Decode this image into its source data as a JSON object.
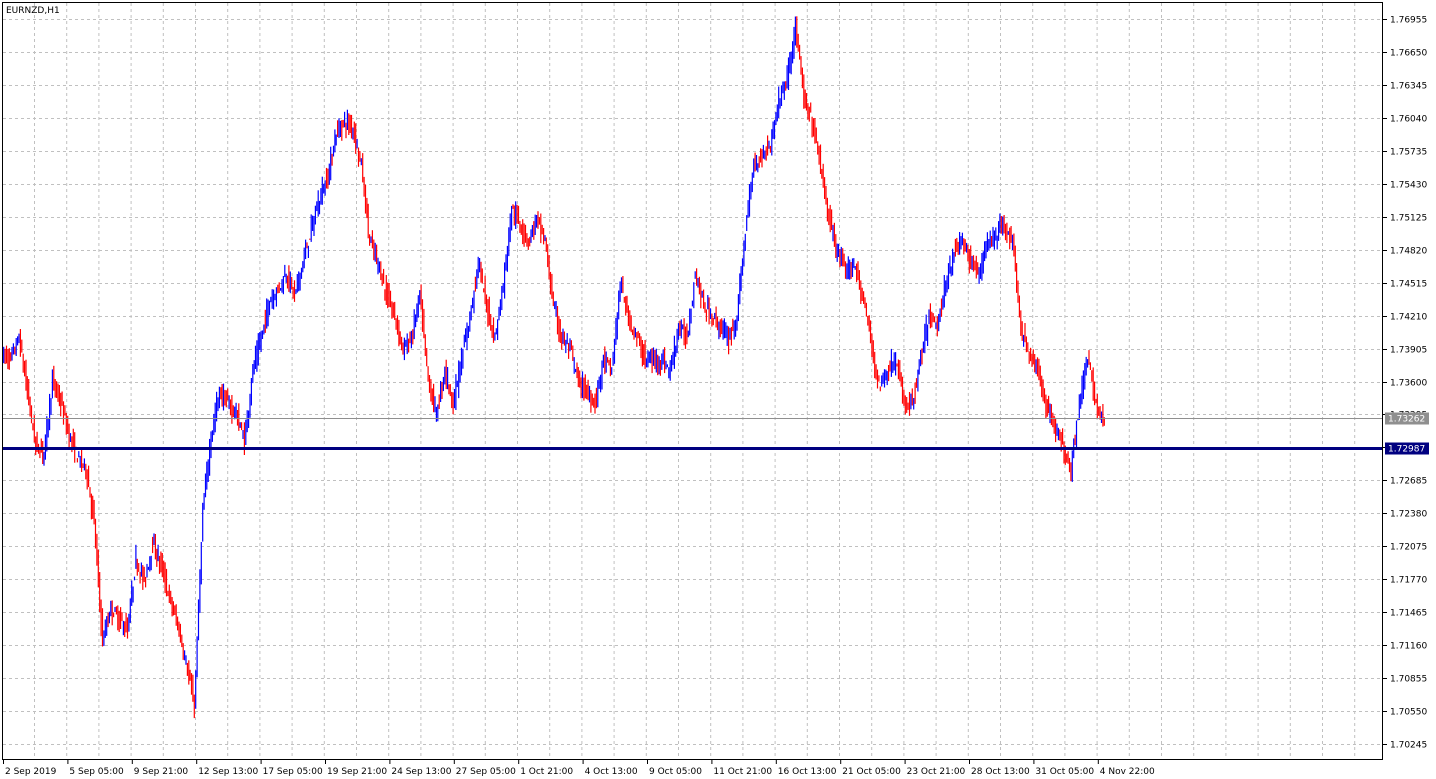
{
  "window": {
    "title": "EURNZD,H1"
  },
  "chart_data": {
    "type": "line",
    "title": "EURNZD,H1",
    "symbol": "EURNZD",
    "timeframe": "H1",
    "grid": true,
    "colors": {
      "background": "#ffffff",
      "grid": "#c0c0c0",
      "bull": "#0000ff",
      "bear": "#ff0000",
      "level": "#000080",
      "bid_tag": "#8f8f8f"
    },
    "ylim": [
      1.701,
      1.771
    ],
    "yticks": [
      "1.76955",
      "1.76650",
      "1.76345",
      "1.76040",
      "1.75735",
      "1.75430",
      "1.75125",
      "1.74820",
      "1.74515",
      "1.74210",
      "1.73905",
      "1.73600",
      "1.73295",
      "1.72990",
      "1.72685",
      "1.72380",
      "1.72075",
      "1.71770",
      "1.71465",
      "1.71160",
      "1.70855",
      "1.70550",
      "1.70245"
    ],
    "xticks": [
      "2 Sep 2019",
      "5 Sep 05:00",
      "9 Sep 21:00",
      "12 Sep 13:00",
      "17 Sep 05:00",
      "19 Sep 21:00",
      "24 Sep 13:00",
      "27 Sep 05:00",
      "1 Oct 21:00",
      "4 Oct 13:00",
      "9 Oct 05:00",
      "11 Oct 21:00",
      "16 Oct 13:00",
      "21 Oct 05:00",
      "23 Oct 21:00",
      "28 Oct 13:00",
      "31 Oct 05:00",
      "4 Nov 22:00"
    ],
    "series": [
      {
        "values": [
          1.7385,
          1.738,
          1.74,
          1.735,
          1.73,
          1.7295,
          1.736,
          1.734,
          1.731,
          1.729,
          1.728,
          1.723,
          1.712,
          1.715,
          1.714,
          1.713,
          1.7195,
          1.7175,
          1.721,
          1.719,
          1.716,
          1.7135,
          1.71,
          1.706,
          1.724,
          1.731,
          1.735,
          1.734,
          1.733,
          1.7305,
          1.737,
          1.74,
          1.7435,
          1.7445,
          1.746,
          1.744,
          1.747,
          1.75,
          1.753,
          1.755,
          1.759,
          1.76,
          1.7595,
          1.756,
          1.749,
          1.747,
          1.744,
          1.742,
          1.739,
          1.74,
          1.744,
          1.736,
          1.733,
          1.737,
          1.734,
          1.738,
          1.742,
          1.747,
          1.743,
          1.74,
          1.745,
          1.752,
          1.7505,
          1.749,
          1.751,
          1.749,
          1.743,
          1.74,
          1.739,
          1.736,
          1.735,
          1.734,
          1.738,
          1.737,
          1.745,
          1.742,
          1.74,
          1.738,
          1.738,
          1.738,
          1.737,
          1.741,
          1.74,
          1.746,
          1.743,
          1.742,
          1.741,
          1.74,
          1.742,
          1.75,
          1.756,
          1.757,
          1.758,
          1.762,
          1.764,
          1.769,
          1.762,
          1.76,
          1.756,
          1.751,
          1.748,
          1.746,
          1.747,
          1.744,
          1.74,
          1.7355,
          1.737,
          1.738,
          1.734,
          1.734,
          1.738,
          1.742,
          1.741,
          1.745,
          1.748,
          1.749,
          1.747,
          1.746,
          1.749,
          1.7495,
          1.7505,
          1.749,
          1.741,
          1.7385,
          1.737,
          1.734,
          1.732,
          1.73,
          1.728,
          1.734,
          1.738,
          1.734,
          1.732
        ]
      }
    ],
    "levels": [
      {
        "value": 1.72987,
        "label": "1.72987"
      }
    ],
    "bid_line": {
      "value": 1.73262,
      "label": "1.73262"
    }
  }
}
